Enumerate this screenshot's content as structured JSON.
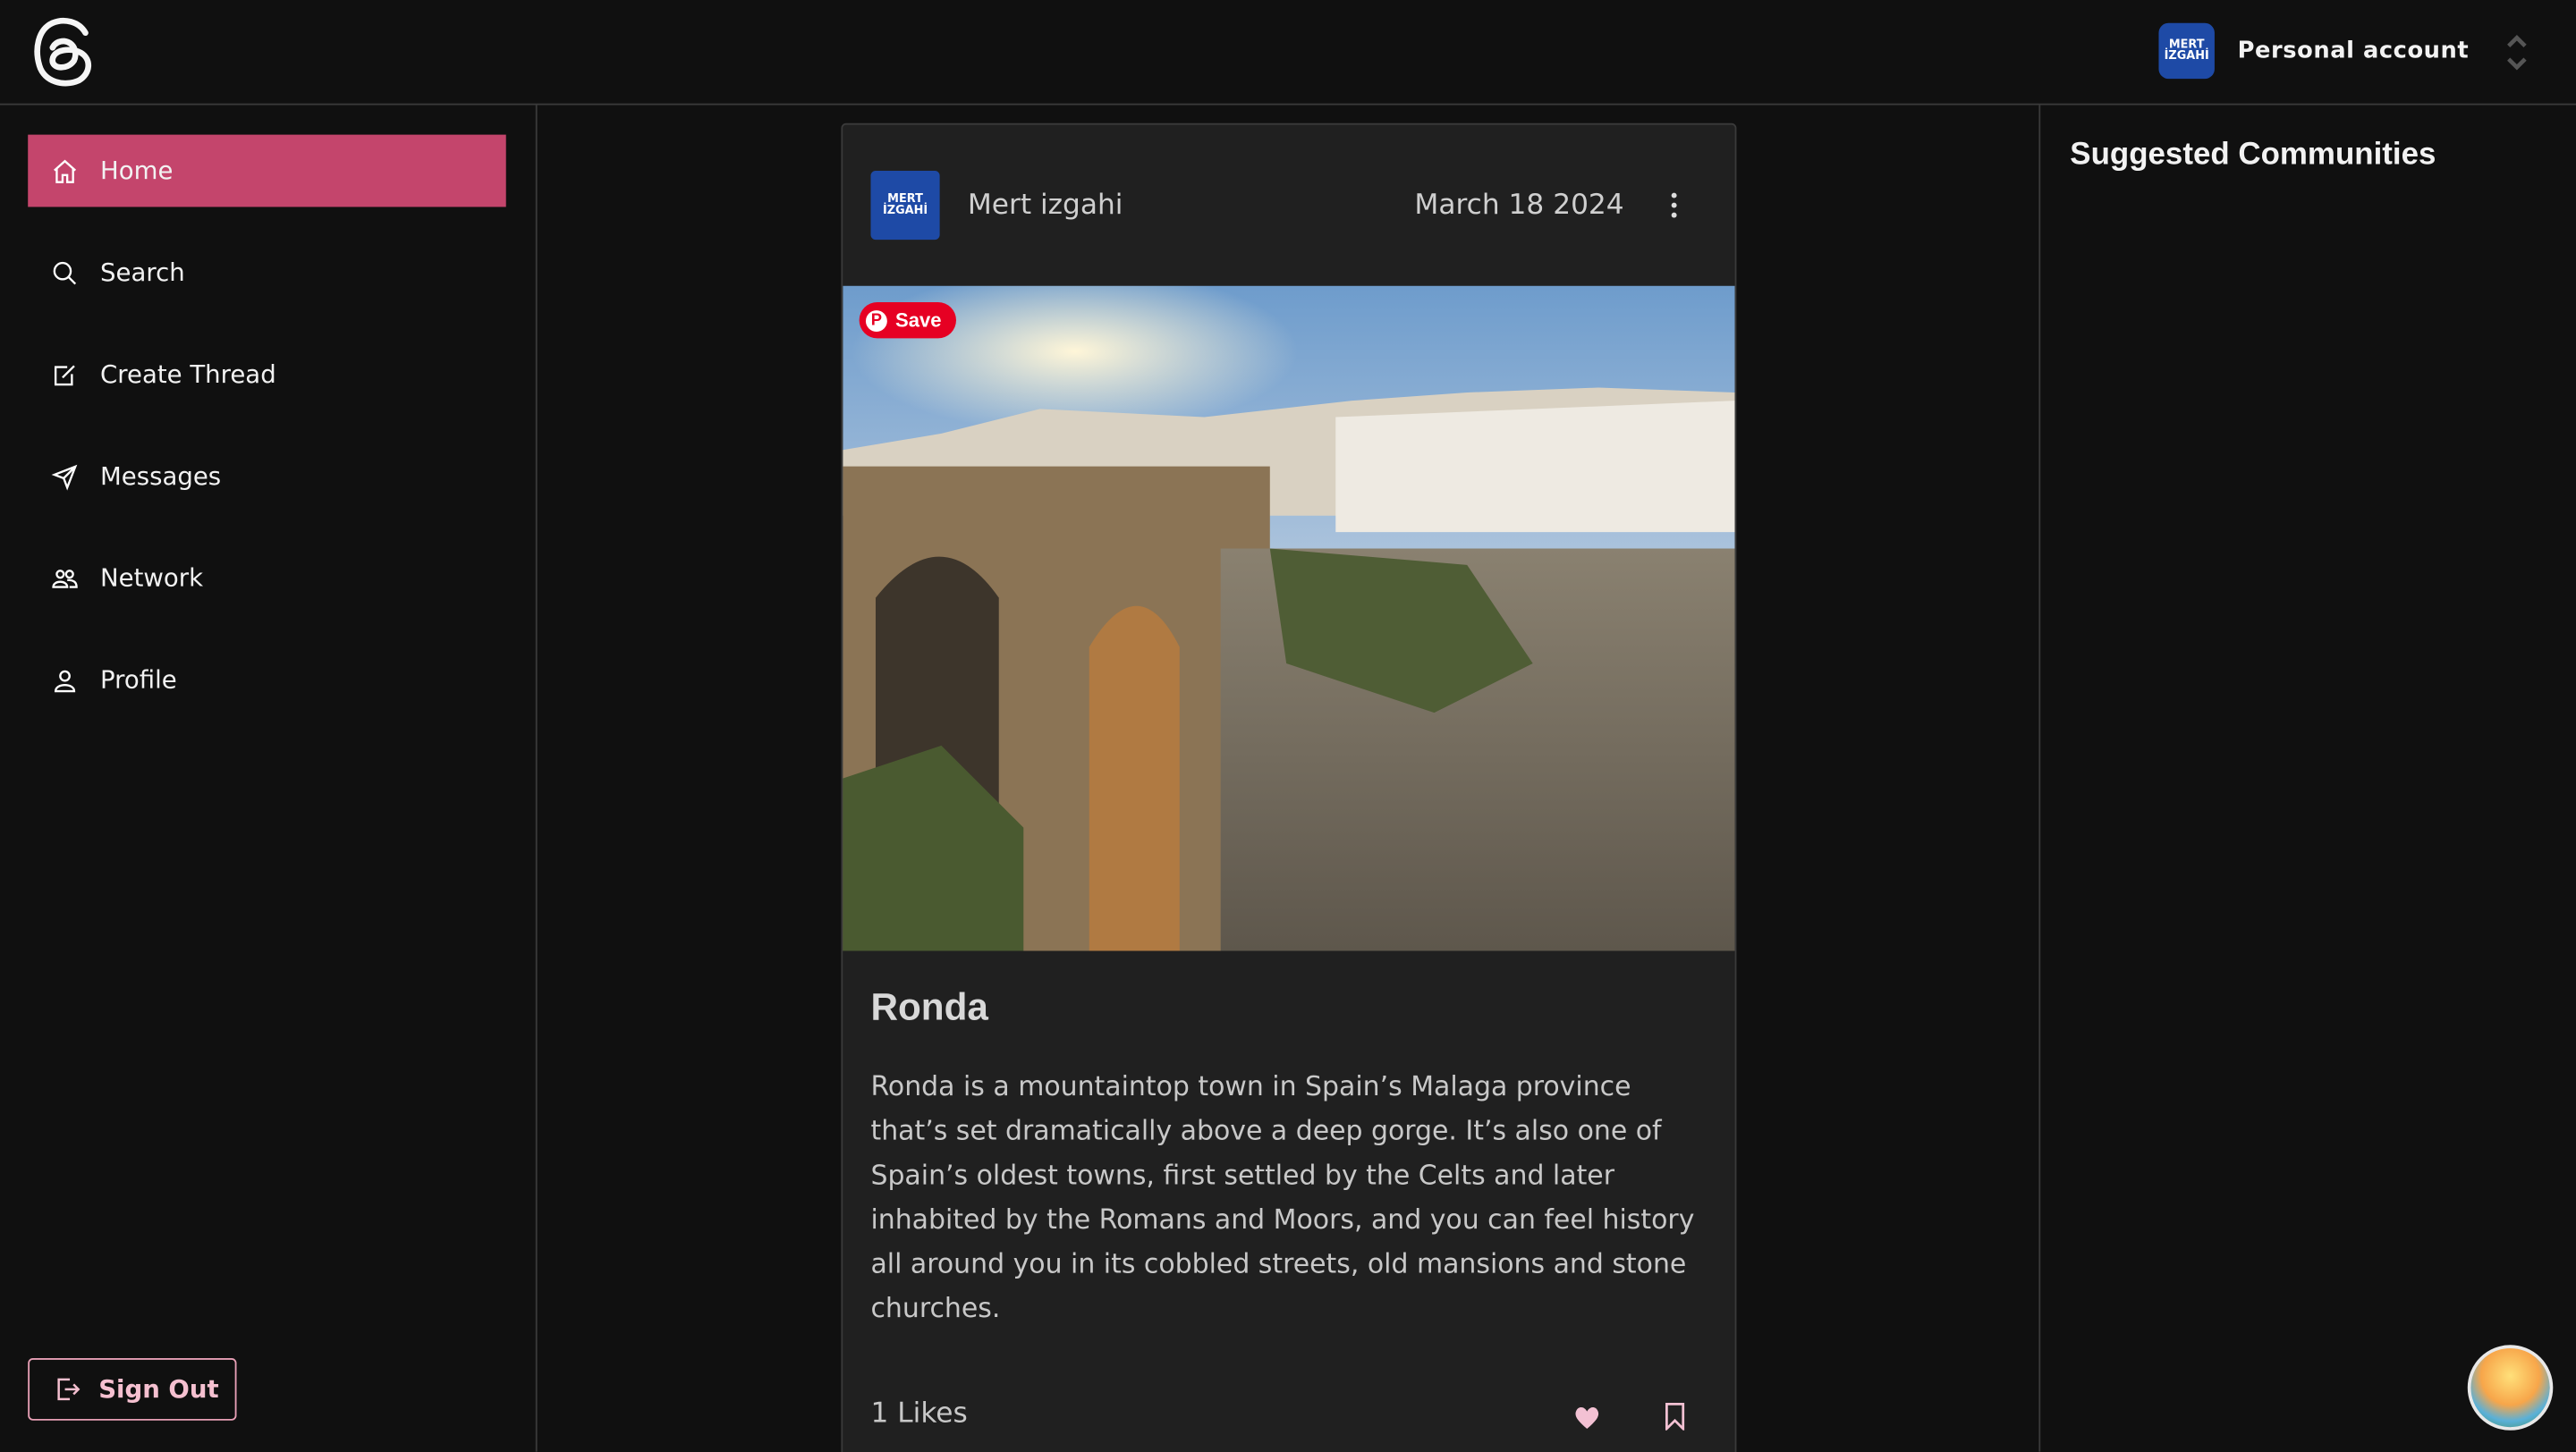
{
  "header": {
    "account_label": "Personal account",
    "account_avatar_text": "MERT İZGAHİ"
  },
  "sidebar": {
    "items": [
      {
        "label": "Home",
        "icon": "home-icon",
        "active": true
      },
      {
        "label": "Search",
        "icon": "search-icon"
      },
      {
        "label": "Create Thread",
        "icon": "edit-icon"
      },
      {
        "label": "Messages",
        "icon": "send-icon"
      },
      {
        "label": "Network",
        "icon": "users-icon"
      },
      {
        "label": "Profile",
        "icon": "user-icon"
      }
    ],
    "sign_out": "Sign Out"
  },
  "right": {
    "title": "Suggested Communities"
  },
  "post": {
    "author": "Mert izgahi",
    "date": "March 18 2024",
    "save_label": "Save",
    "title": "Ronda",
    "body": "Ronda is a mountaintop town in Spain’s Malaga province that’s set dramatically above a deep gorge. It’s also one of Spain’s oldest towns, first settled by the Celts and later inhabited by the Romans and Moors, and you can feel history all around you in its cobbled streets, old mansions and stone churches.",
    "likes": "1  Likes"
  },
  "colors": {
    "accent": "#c4456c",
    "like": "#f3c1d3",
    "background": "#101010",
    "card": "#202020"
  }
}
